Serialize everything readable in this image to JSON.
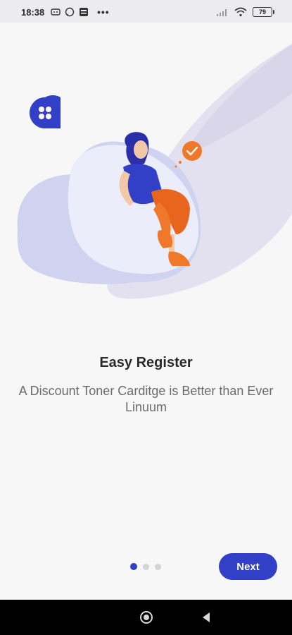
{
  "status_bar": {
    "time": "18:38",
    "battery": "79",
    "icons": [
      "messaging-icon",
      "whatsapp-icon",
      "news-icon",
      "more-dots-icon",
      "signal-icon",
      "wifi-icon",
      "battery-icon"
    ],
    "dots": "•••"
  },
  "illustration": {
    "name": "person-on-beanbag",
    "accent_color": "#3140c6",
    "secondary_color": "#f0782a"
  },
  "onboarding": {
    "title": "Easy Register",
    "subtitle": "A Discount Toner Carditge is Better than Ever Linuum",
    "page_count": 3,
    "current_page": 1
  },
  "actions": {
    "next_label": "Next"
  },
  "nav_bar": {
    "icons": [
      "home-icon",
      "back-icon"
    ]
  }
}
